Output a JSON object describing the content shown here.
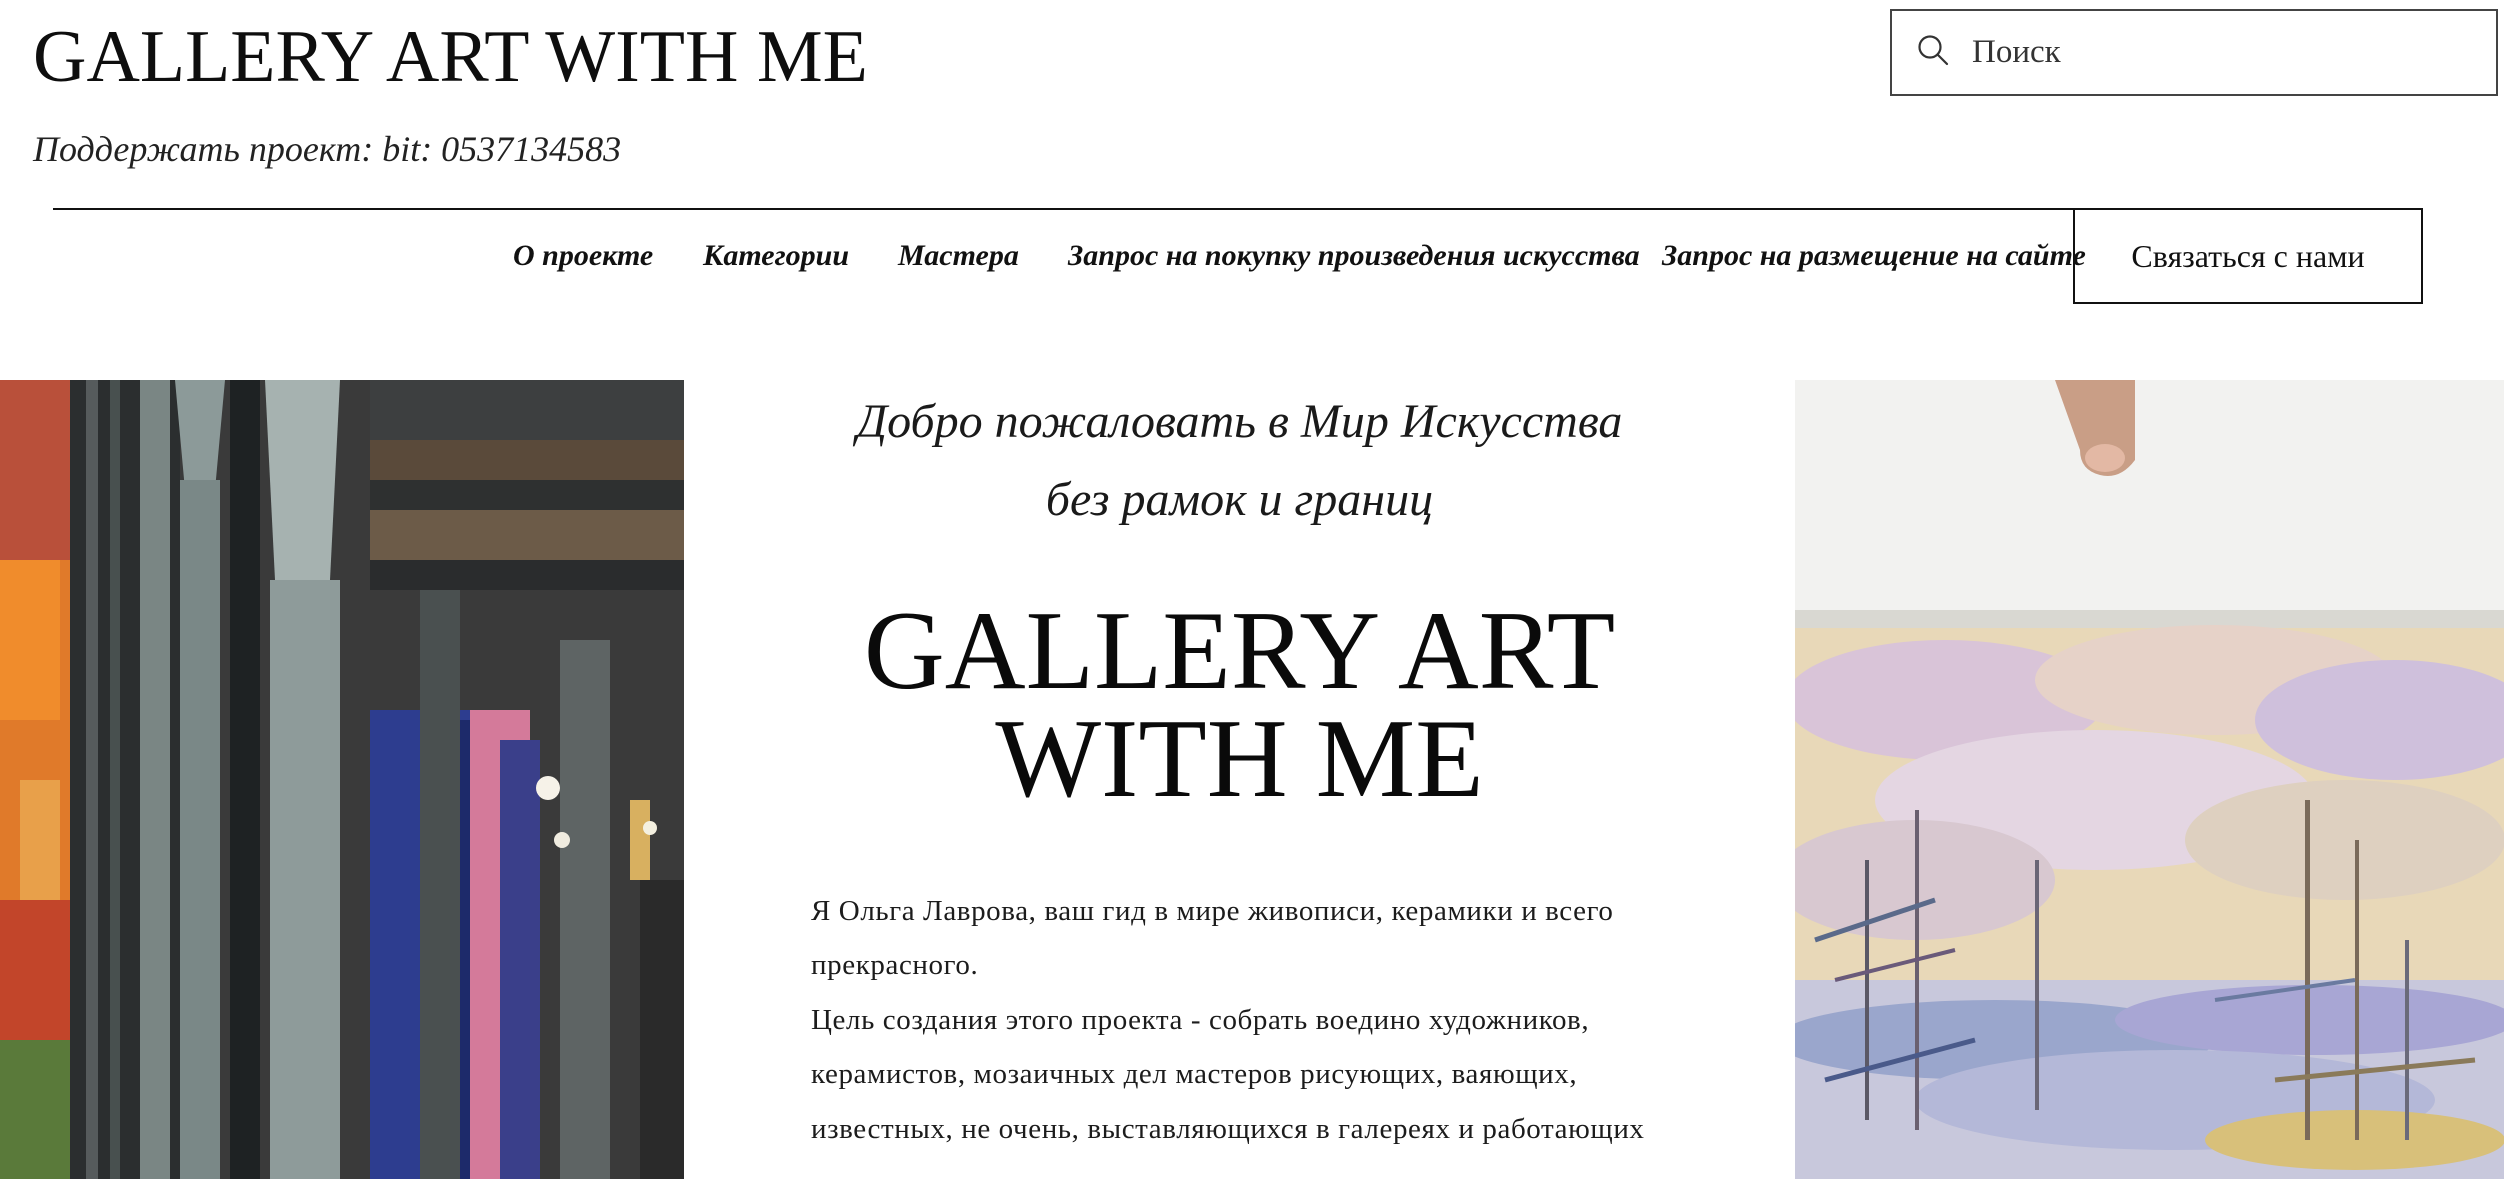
{
  "header": {
    "site_title": "GALLERY ART WITH ME",
    "support_text": "Поддержать проект: bit: 0537134583",
    "search": {
      "placeholder": "Поиск",
      "value": ""
    }
  },
  "nav": {
    "items": [
      {
        "label": "О проекте"
      },
      {
        "label": "Категории"
      },
      {
        "label": "Мастера"
      },
      {
        "label": "Запрос на покупку произведения искусства"
      },
      {
        "label": "Запрос на размещение на сайте"
      }
    ],
    "contact_label": "Связаться с нами"
  },
  "hero": {
    "welcome_line1": "Добро пожаловать в Мир Искусства",
    "welcome_line2": "без рамок и границ",
    "title_line1": "GALLERY ART",
    "title_line2": "WITH ME",
    "paragraph1_line1": "Я Ольга Лаврова, ваш гид в мире живописи, керамики и всего",
    "paragraph1_line2": "прекрасного.",
    "paragraph2_line1": "Цель создания этого проекта - собрать воедино художников,",
    "paragraph2_line2": "керамистов, мозаичных дел мастеров рисующих, ваяющих,",
    "paragraph2_line3": "известных, не очень, выставляющихся в галереях и работающих"
  },
  "icons": {
    "search": "search-icon"
  },
  "colors": {
    "text": "#111111",
    "background": "#ffffff",
    "border": "#444444"
  }
}
